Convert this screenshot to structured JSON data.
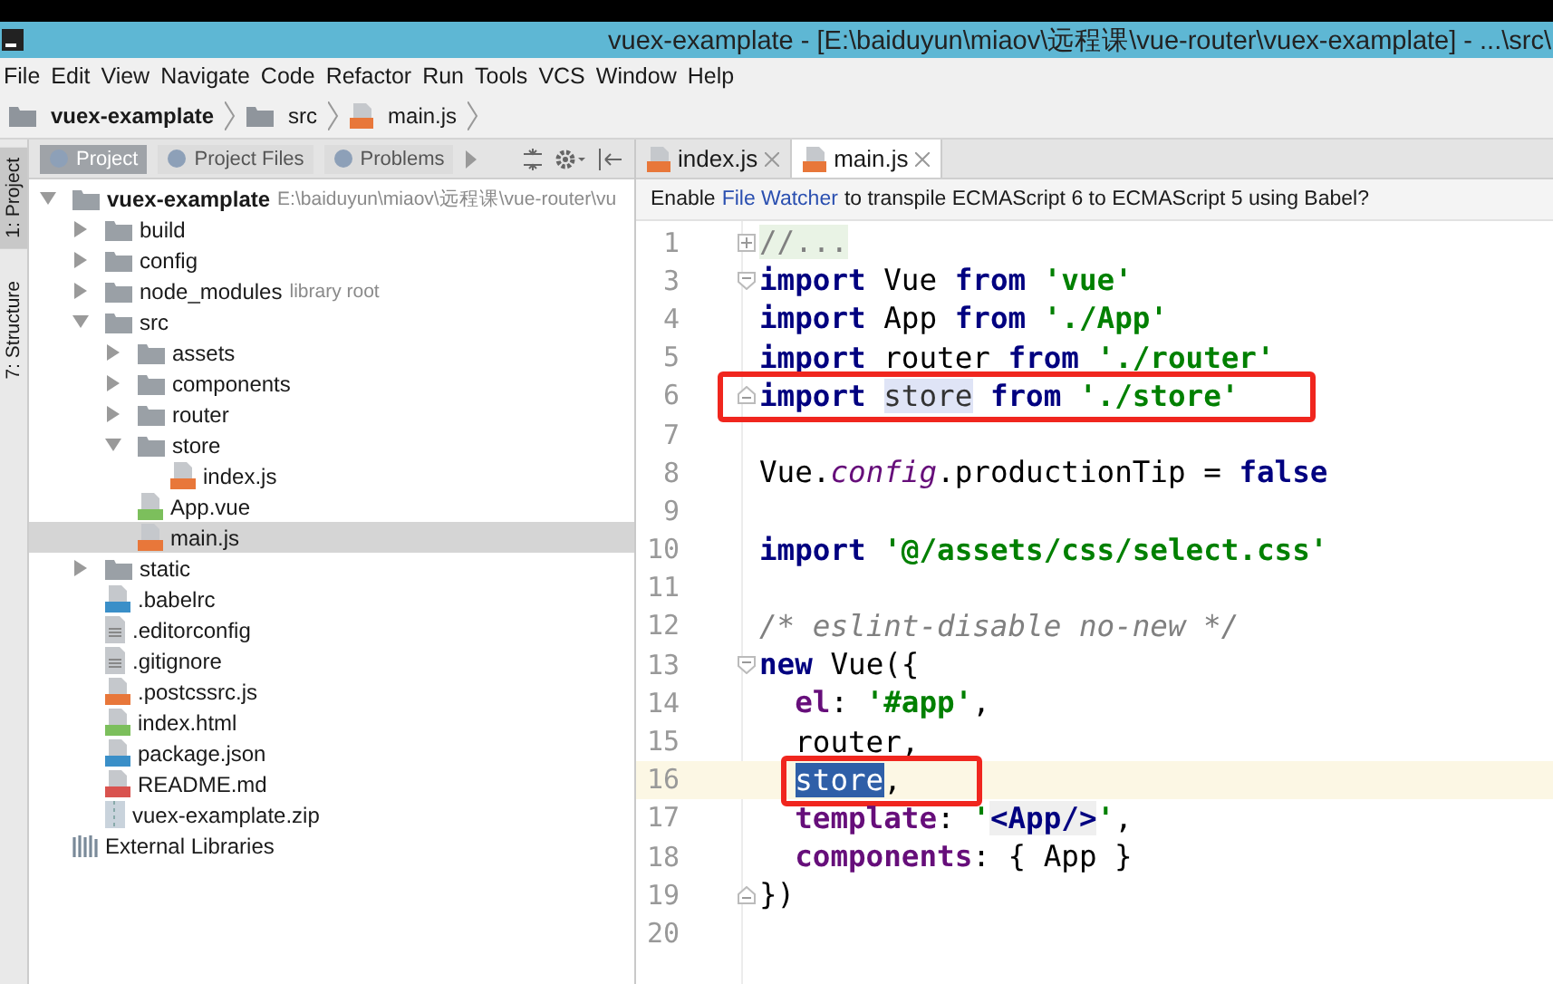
{
  "window": {
    "title": "vuex-examplate - [E:\\baiduyun\\miaov\\远程课\\vue-router\\vuex-examplate] - ...\\src\\"
  },
  "menu": [
    "File",
    "Edit",
    "View",
    "Navigate",
    "Code",
    "Refactor",
    "Run",
    "Tools",
    "VCS",
    "Window",
    "Help"
  ],
  "breadcrumbs": [
    {
      "label": "vuex-examplate",
      "kind": "project"
    },
    {
      "label": "src",
      "kind": "folder"
    },
    {
      "label": "main.js",
      "kind": "js"
    }
  ],
  "side_strip": [
    {
      "label": "1: Project",
      "selected": true
    },
    {
      "label": "7: Structure",
      "selected": false
    }
  ],
  "tool_tabs": [
    {
      "label": "Project",
      "selected": true
    },
    {
      "label": "Project Files",
      "selected": false
    },
    {
      "label": "Problems",
      "selected": false
    }
  ],
  "project_tree": [
    {
      "label": "vuex-examplate",
      "hint": "E:\\baiduyun\\miaov\\远程课\\vue-router\\vu",
      "kind": "project",
      "expanded": true,
      "selected": false,
      "children": [
        {
          "label": "build",
          "kind": "folder",
          "expanded": false,
          "selected": false
        },
        {
          "label": "config",
          "kind": "folder",
          "expanded": false,
          "selected": false
        },
        {
          "label": "node_modules",
          "hint": "library root",
          "kind": "folder",
          "expanded": false,
          "selected": false
        },
        {
          "label": "src",
          "kind": "folder",
          "expanded": true,
          "selected": false,
          "children": [
            {
              "label": "assets",
              "kind": "folder",
              "expanded": false,
              "selected": false
            },
            {
              "label": "components",
              "kind": "folder",
              "expanded": false,
              "selected": false
            },
            {
              "label": "router",
              "kind": "folder",
              "expanded": false,
              "selected": false
            },
            {
              "label": "store",
              "kind": "folder",
              "expanded": true,
              "selected": false,
              "children": [
                {
                  "label": "index.js",
                  "kind": "js",
                  "selected": false
                }
              ]
            },
            {
              "label": "App.vue",
              "kind": "vue",
              "selected": false
            },
            {
              "label": "main.js",
              "kind": "js",
              "selected": true
            }
          ]
        },
        {
          "label": "static",
          "kind": "folder",
          "expanded": false,
          "selected": false
        },
        {
          "label": ".babelrc",
          "kind": "json",
          "selected": false
        },
        {
          "label": ".editorconfig",
          "kind": "text",
          "selected": false
        },
        {
          "label": ".gitignore",
          "kind": "text",
          "selected": false
        },
        {
          "label": ".postcssrc.js",
          "kind": "js",
          "selected": false
        },
        {
          "label": "index.html",
          "kind": "html",
          "selected": false
        },
        {
          "label": "package.json",
          "kind": "json",
          "selected": false
        },
        {
          "label": "README.md",
          "kind": "md",
          "selected": false
        },
        {
          "label": "vuex-examplate.zip",
          "kind": "zip",
          "selected": false
        }
      ]
    },
    {
      "label": "External Libraries",
      "kind": "libraries",
      "selected": false
    }
  ],
  "editor_tabs": [
    {
      "label": "index.js",
      "selected": false
    },
    {
      "label": "main.js",
      "selected": true
    }
  ],
  "notice": {
    "before": "Enable ",
    "link": "File Watcher",
    "after": " to transpile ECMAScript 6 to ECMAScript 5 using Babel?"
  },
  "code_lines": [
    {
      "number": "1",
      "kind": "folded",
      "indented": false,
      "current": false,
      "boxed": false,
      "tokens": [
        {
          "text": "//...",
          "kind": "folded"
        }
      ]
    },
    {
      "number": "3",
      "kind": "opener",
      "indented": false,
      "current": false,
      "boxed": false,
      "tokens": [
        {
          "text": "import ",
          "kind": "kw"
        },
        {
          "text": "Vue ",
          "kind": "plain"
        },
        {
          "text": "from ",
          "kind": "kw"
        },
        {
          "text": "'vue'",
          "kind": "str"
        }
      ]
    },
    {
      "number": "4",
      "kind": "plain",
      "indented": false,
      "current": false,
      "boxed": false,
      "tokens": [
        {
          "text": "import ",
          "kind": "kw"
        },
        {
          "text": "App ",
          "kind": "plain"
        },
        {
          "text": "from ",
          "kind": "kw"
        },
        {
          "text": "'./App'",
          "kind": "str"
        }
      ]
    },
    {
      "number": "5",
      "kind": "plain",
      "indented": false,
      "current": false,
      "boxed": false,
      "tokens": [
        {
          "text": "import ",
          "kind": "kw"
        },
        {
          "text": "router ",
          "kind": "plain"
        },
        {
          "text": "from ",
          "kind": "kw"
        },
        {
          "text": "'./router'",
          "kind": "str"
        }
      ]
    },
    {
      "number": "6",
      "kind": "closer",
      "indented": false,
      "current": false,
      "boxed": true,
      "tokens": [
        {
          "text": "import ",
          "kind": "kw"
        },
        {
          "text": "store",
          "kind": "usage"
        },
        {
          "text": " from ",
          "kind": "kw"
        },
        {
          "text": "'./store'",
          "kind": "str"
        }
      ]
    },
    {
      "number": "7",
      "kind": "plain",
      "indented": false,
      "current": false,
      "boxed": false
    },
    {
      "number": "8",
      "kind": "plain",
      "indented": false,
      "current": false,
      "boxed": false,
      "tokens": [
        {
          "text": "Vue.",
          "kind": "plain"
        },
        {
          "text": "config",
          "kind": "prop"
        },
        {
          "text": ".productionTip = ",
          "kind": "plain"
        },
        {
          "text": "false",
          "kind": "kw"
        }
      ]
    },
    {
      "number": "9",
      "kind": "plain",
      "indented": false,
      "current": false,
      "boxed": false
    },
    {
      "number": "10",
      "kind": "plain",
      "indented": false,
      "current": false,
      "boxed": false,
      "tokens": [
        {
          "text": "import ",
          "kind": "kw"
        },
        {
          "text": "'@/assets/css/select.css'",
          "kind": "str"
        }
      ]
    },
    {
      "number": "11",
      "kind": "plain",
      "indented": false,
      "current": false,
      "boxed": false
    },
    {
      "number": "12",
      "kind": "plain",
      "indented": false,
      "current": false,
      "boxed": false,
      "tokens": [
        {
          "text": "/* eslint-disable no-new */",
          "kind": "comment"
        }
      ]
    },
    {
      "number": "13",
      "kind": "opener",
      "indented": false,
      "current": false,
      "boxed": false,
      "tokens": [
        {
          "text": "new ",
          "kind": "kw"
        },
        {
          "text": "Vue({",
          "kind": "plain"
        }
      ]
    },
    {
      "number": "14",
      "kind": "plain",
      "indented": true,
      "current": false,
      "boxed": false,
      "tokens": [
        {
          "text": "el",
          "kind": "key"
        },
        {
          "text": ": ",
          "kind": "plain"
        },
        {
          "text": "'#app'",
          "kind": "str"
        },
        {
          "text": ",",
          "kind": "plain"
        }
      ]
    },
    {
      "number": "15",
      "kind": "plain",
      "indented": true,
      "current": false,
      "boxed": false,
      "tokens": [
        {
          "text": "router,",
          "kind": "plain"
        }
      ]
    },
    {
      "number": "16",
      "kind": "plain",
      "indented": true,
      "current": true,
      "boxed": true,
      "tokens": [
        {
          "text": "store",
          "kind": "selection"
        },
        {
          "text": ",",
          "kind": "plain"
        }
      ]
    },
    {
      "number": "17",
      "kind": "plain",
      "indented": true,
      "current": false,
      "boxed": false,
      "tokens": [
        {
          "text": "template",
          "kind": "key"
        },
        {
          "text": ": ",
          "kind": "plain"
        },
        {
          "text": "'",
          "kind": "str"
        },
        {
          "text": "<App/>",
          "kind": "tag"
        },
        {
          "text": "'",
          "kind": "str"
        },
        {
          "text": ",",
          "kind": "plain"
        }
      ]
    },
    {
      "number": "18",
      "kind": "plain",
      "indented": true,
      "current": false,
      "boxed": false,
      "tokens": [
        {
          "text": "components",
          "kind": "key"
        },
        {
          "text": ": { App }",
          "kind": "plain"
        }
      ]
    },
    {
      "number": "19",
      "kind": "closer",
      "indented": false,
      "current": false,
      "boxed": false,
      "tokens": [
        {
          "text": "})",
          "kind": "plain"
        }
      ]
    },
    {
      "number": "20",
      "kind": "plain",
      "indented": false,
      "current": false,
      "boxed": false
    }
  ]
}
